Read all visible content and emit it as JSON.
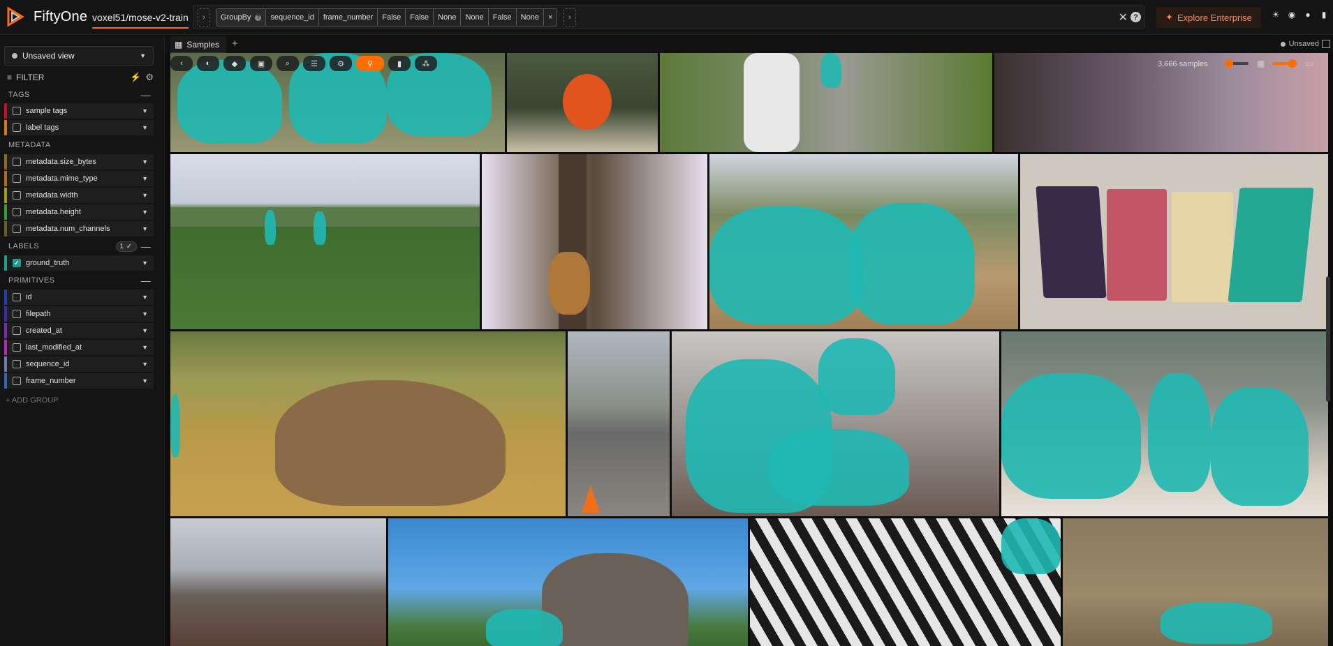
{
  "app": {
    "brand": "FiftyOne",
    "dataset": "voxel51/mose-v2-train"
  },
  "view_bar": {
    "stage_name": "GroupBy",
    "params": [
      "sequence_id",
      "frame_number",
      "False",
      "False",
      "None",
      "None",
      "False",
      "None"
    ],
    "close": "×",
    "clear": "✕",
    "help": "?"
  },
  "header": {
    "explore_label": "Explore Enterprise"
  },
  "tabs": {
    "samples_label": "Samples",
    "add": "+",
    "unsaved_label": "Unsaved"
  },
  "sidebar": {
    "view_select": "Unsaved view",
    "filter_label": "FILTER",
    "groups": {
      "tags": "TAGS",
      "metadata": "METADATA",
      "labels": "LABELS",
      "primitives": "PRIMITIVES"
    },
    "labels_count": "1 ✓",
    "tag_fields": [
      "sample tags",
      "label tags"
    ],
    "metadata_fields": [
      "metadata.size_bytes",
      "metadata.mime_type",
      "metadata.width",
      "metadata.height",
      "metadata.num_channels"
    ],
    "label_fields": [
      "ground_truth"
    ],
    "primitive_fields": [
      "id",
      "filepath",
      "created_at",
      "last_modified_at",
      "sequence_id",
      "frame_number"
    ],
    "add_group": "+ ADD GROUP"
  },
  "grid": {
    "sample_count": "3,666 samples"
  },
  "colors": {
    "accent": "#ff6d04",
    "segmentation": "#1fb8b2"
  }
}
